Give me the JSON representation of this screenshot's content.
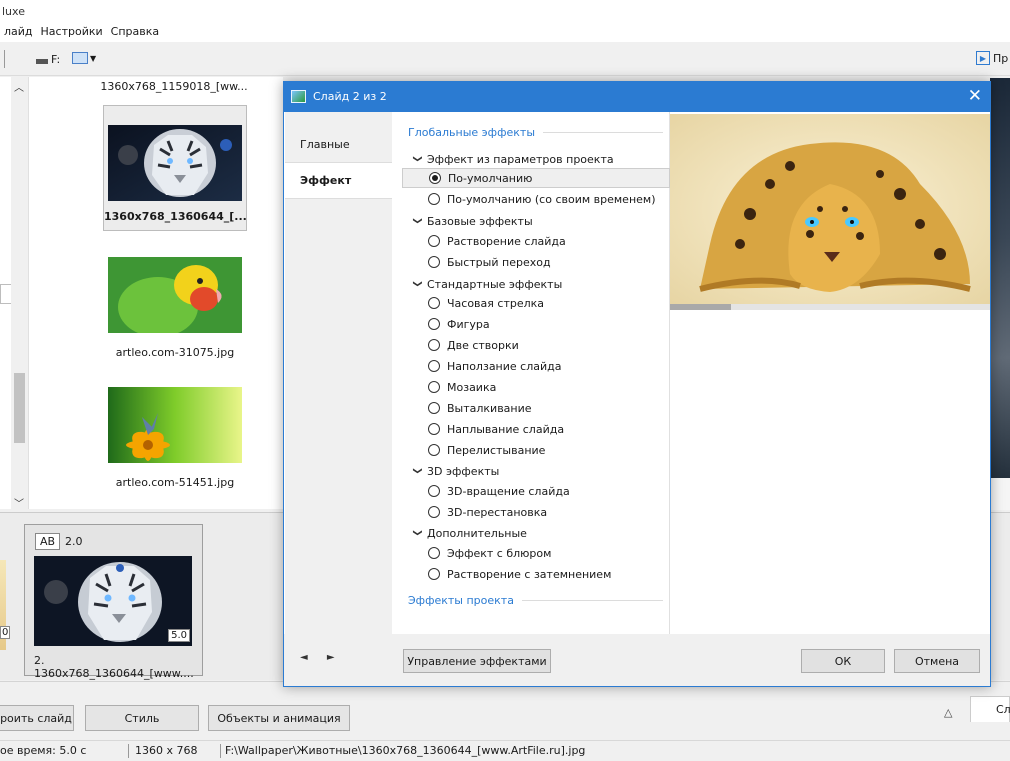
{
  "app": {
    "title_fragment": "luxe"
  },
  "menu": [
    "лайд",
    "Настройки",
    "Справка"
  ],
  "toolbar": {
    "drive": "F:",
    "preview_label": "Пр"
  },
  "file_list": {
    "top_name": "1360x768_1159018_[ww...",
    "items": [
      {
        "name": "1360x768_1360644_[...",
        "selected": true
      },
      {
        "name": "artleo.com-31075.jpg",
        "selected": false
      },
      {
        "name": "artleo.com-51451.jpg",
        "selected": false
      }
    ]
  },
  "timeline": {
    "prev_slide_duration": "0",
    "slide": {
      "transition_badge": "AB",
      "transition_duration": "2.0",
      "duration": "5.0",
      "caption": "2. 1360x768_1360644_[www...."
    }
  },
  "bottom": {
    "buttons": [
      "роить слайд",
      "Стиль",
      "Объекты и анимация"
    ],
    "tab_label": "Сл"
  },
  "status": {
    "time": "ое время: 5.0 с",
    "resolution": "1360 x 768",
    "path": "F:\\Wallpaper\\Животные\\1360x768_1360644_[www.ArtFile.ru].jpg"
  },
  "dialog": {
    "title": "Слайд 2 из 2",
    "close": "✕",
    "nav_tabs": [
      {
        "label": "Главные",
        "active": false
      },
      {
        "label": "Эффект",
        "active": true
      }
    ],
    "global_effects_header": "Глобальные эффекты",
    "project_effects_header": "Эффекты проекта",
    "categories": [
      {
        "label": "Эффект из параметров проекта",
        "options": [
          {
            "label": "По-умолчанию",
            "selected": true
          },
          {
            "label": "По-умолчанию (со своим временем)",
            "selected": false
          }
        ]
      },
      {
        "label": "Базовые эффекты",
        "options": [
          {
            "label": "Растворение слайда",
            "selected": false
          },
          {
            "label": "Быстрый переход",
            "selected": false
          }
        ]
      },
      {
        "label": "Стандартные эффекты",
        "options": [
          {
            "label": "Часовая стрелка",
            "selected": false
          },
          {
            "label": "Фигура",
            "selected": false
          },
          {
            "label": "Две створки",
            "selected": false
          },
          {
            "label": "Наползание слайда",
            "selected": false
          },
          {
            "label": "Мозаика",
            "selected": false
          },
          {
            "label": "Выталкивание",
            "selected": false
          },
          {
            "label": "Наплывание слайда",
            "selected": false
          },
          {
            "label": "Перелистывание",
            "selected": false
          }
        ]
      },
      {
        "label": "3D эффекты",
        "options": [
          {
            "label": "3D-вращение слайда",
            "selected": false
          },
          {
            "label": "3D-перестановка",
            "selected": false
          }
        ]
      },
      {
        "label": "Дополнительные",
        "options": [
          {
            "label": "Эффект с блюром",
            "selected": false
          },
          {
            "label": "Растворение с затемнением",
            "selected": false
          }
        ]
      }
    ],
    "preview_progress": 0.19,
    "footer": {
      "nav": "◄ ►",
      "manage": "Управление эффектами",
      "ok": "ОК",
      "cancel": "Отмена"
    }
  },
  "colors": {
    "accent": "#2b7bd2"
  }
}
